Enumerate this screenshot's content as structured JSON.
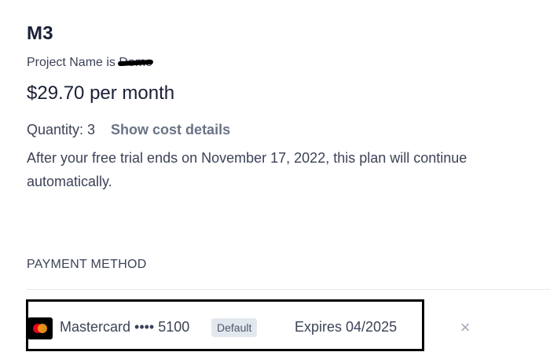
{
  "plan": {
    "name": "M3",
    "project_prefix": "Project Name is",
    "project_name": "Demo",
    "price": "$29.70 per month",
    "quantity": "Quantity: 3",
    "cost_details_link": "Show cost details",
    "trial_note": "After your free trial ends on November 17, 2022, this plan will continue automatically."
  },
  "payment": {
    "heading": "PAYMENT METHOD",
    "card": {
      "icon": "mastercard-icon",
      "label": "Mastercard •••• 5100",
      "badge": "Default",
      "expiry": "Expires 04/2025"
    },
    "remove_glyph": "×"
  },
  "colors": {
    "text_primary": "#1a1f36",
    "text_secondary": "#3c4257",
    "link": "#697386",
    "badge_bg": "#e3e8ee",
    "highlight_border": "#000000"
  }
}
